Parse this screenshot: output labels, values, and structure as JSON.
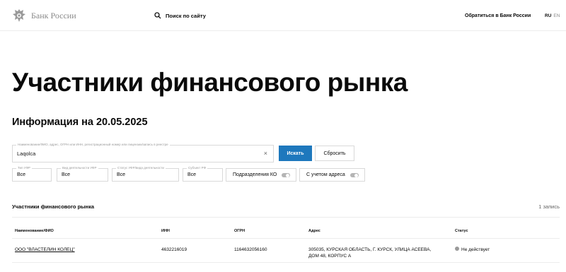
{
  "header": {
    "logo_text": "Банк России",
    "search_label": "Поиск по сайту",
    "contact_label": "Обратиться в Банк России",
    "lang_active": "RU",
    "lang_other": "EN"
  },
  "page": {
    "title": "Участники финансового рынка",
    "info_date": "Информация на 20.05.2025"
  },
  "search": {
    "input_label": "Наименование/ФИО, адрес, ОГРН или ИНН, регистрационный номер или лицензии/запись в реестре",
    "input_value": "Laqolca",
    "clear_symbol": "×",
    "search_button": "Искать",
    "reset_button": "Сбросить"
  },
  "filters": {
    "type_label": "Тип УФР",
    "type_value": "Все",
    "activity_label": "Вид деятельности УФР",
    "activity_value": "Все",
    "status_label": "Статус УФР/вида деятельности",
    "status_value": "Все",
    "region_label": "Субъект РФ",
    "region_value": "Все",
    "toggle_branches": "Подразделения КО",
    "toggle_address": "С учетом адреса"
  },
  "results": {
    "section_title": "Участники финансового рынка",
    "count": "1 запись",
    "columns": [
      "Наименование/ФИО",
      "ИНН",
      "ОГРН",
      "Адрес",
      "Статус"
    ],
    "rows": [
      {
        "name": "ООО \"ВЛАСТЕЛИН КОЛЕЦ\"",
        "inn": "4632216019",
        "ogrn": "1164632056160",
        "address_line1": "305035, КУРСКАЯ ОБЛАСТЬ, Г. КУРСК, УЛИЦА АСЕЕВА,",
        "address_line2": "ДОМ 48, КОРПУС А",
        "status": "Не действует"
      }
    ]
  },
  "colors": {
    "accent": "#1e78bd",
    "status_inactive": "#9a9a9a"
  }
}
